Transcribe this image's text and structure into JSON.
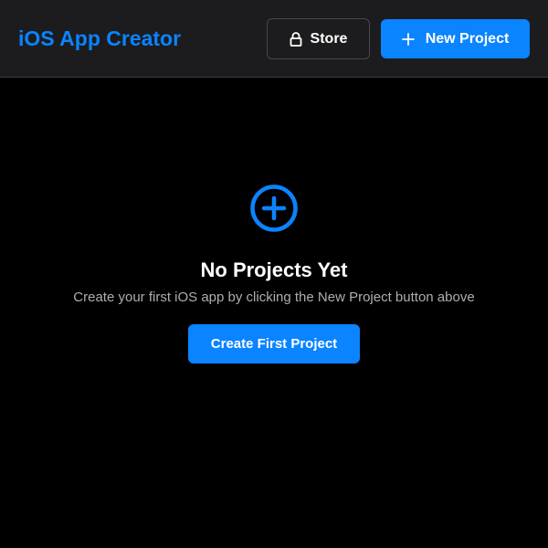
{
  "header": {
    "app_title": "iOS App Creator",
    "store_label": "Store",
    "store_icon": "lock-icon",
    "new_project_label": "New Project",
    "new_project_icon": "plus-icon"
  },
  "empty_state": {
    "icon": "plus-circle-icon",
    "title": "No Projects Yet",
    "subtitle": "Create your first iOS app by clicking the New Project button above",
    "cta_label": "Create First Project"
  },
  "colors": {
    "accent": "#0a84ff",
    "background": "#000000",
    "header_background": "#1c1c1e",
    "secondary_text": "#aeaeb2"
  }
}
